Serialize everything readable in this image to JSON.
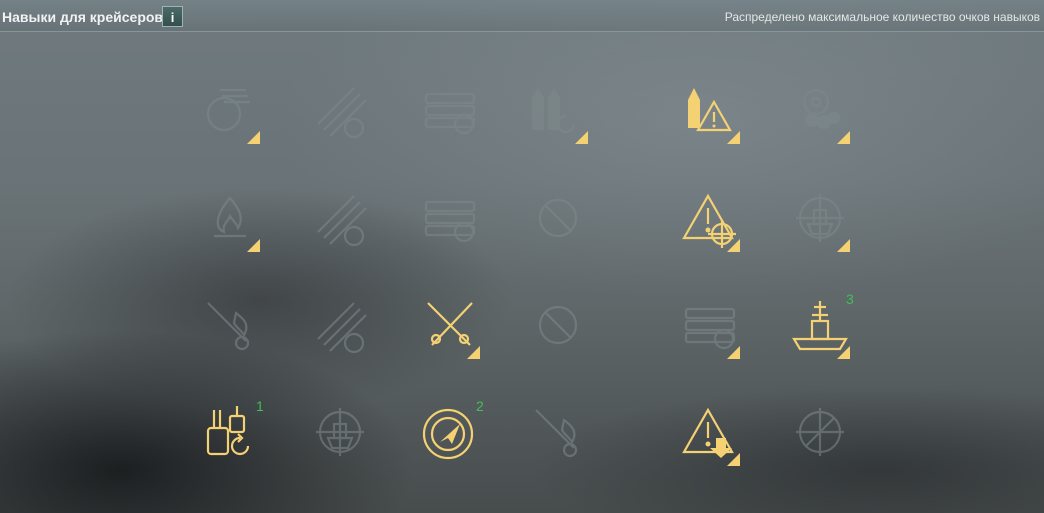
{
  "header": {
    "title": "Навыки для крейсеров",
    "info_label": "i",
    "status": "Распределено максимальное количество очков навыков"
  },
  "colors": {
    "active": "#f4d173",
    "inactive": "#7f8a8d",
    "order": "#3fbf58"
  },
  "skills": [
    {
      "icon": "gun-turret-swap-icon",
      "state": "inactive"
    },
    {
      "icon": "torpedo-reload-icon",
      "state": "inactive"
    },
    {
      "icon": "torpedo-tubes-reload-icon",
      "state": "inactive"
    },
    {
      "icon": "shells-reload-icon",
      "state": "inactive"
    },
    {
      "icon": "shell-warning-icon",
      "state": "active"
    },
    {
      "icon": "helm-smoke-icon",
      "state": "inactive"
    },
    {
      "icon": "fire-icon",
      "state": "inactive"
    },
    {
      "icon": "torpedo-reload-2-icon",
      "state": "inactive"
    },
    {
      "icon": "torpedo-tubes-crosshair-icon",
      "state": "inactive"
    },
    {
      "icon": "blocked-icon",
      "state": "inactive"
    },
    {
      "icon": "warning-crosshair-icon",
      "state": "active"
    },
    {
      "icon": "ship-stern-icon",
      "state": "inactive"
    },
    {
      "icon": "anti-aircraft-fire-icon",
      "state": "inactive"
    },
    {
      "icon": "torpedo-repair-icon",
      "state": "inactive"
    },
    {
      "icon": "crossed-guns-icon",
      "state": "selected"
    },
    {
      "icon": "blocked-icon",
      "state": "inactive"
    },
    {
      "icon": "torpedo-tubes-stack-icon",
      "state": "inactive"
    },
    {
      "icon": "battleship-icon",
      "state": "selected",
      "order": "3"
    },
    {
      "icon": "turret-rotation-icon",
      "state": "selected",
      "order": "1"
    },
    {
      "icon": "ship-crosshair-icon",
      "state": "inactive"
    },
    {
      "icon": "radar-compass-icon",
      "state": "selected",
      "order": "2"
    },
    {
      "icon": "aircraft-fire-icon",
      "state": "inactive"
    },
    {
      "icon": "warning-down-icon",
      "state": "active"
    },
    {
      "icon": "targeted-aircraft-icon",
      "state": "inactive"
    }
  ]
}
